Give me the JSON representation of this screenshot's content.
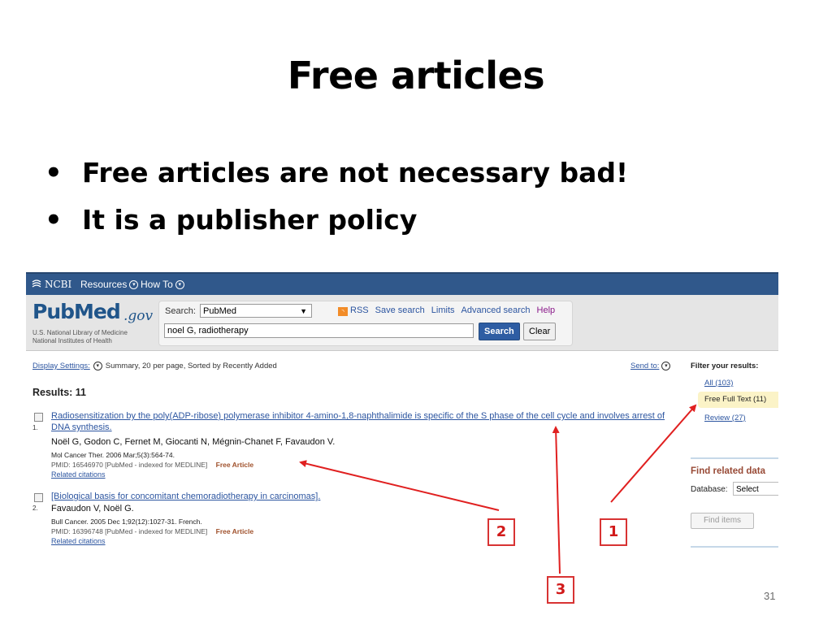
{
  "slide": {
    "title": "Free articles",
    "bullets": [
      "Free articles are not necessary bad!",
      "It is a publisher policy"
    ],
    "page_number": "31",
    "callouts": [
      "1",
      "2",
      "3"
    ],
    "arrow_color": "#e02020"
  },
  "ncbi_bar": {
    "brand": "NCBI",
    "items": [
      "Resources",
      "How To"
    ],
    "bg_color": "#30588b"
  },
  "logo": {
    "word": "PubMed",
    "gov": ".gov",
    "line1": "U.S. National Library of Medicine",
    "line2": "National Institutes of Health"
  },
  "search": {
    "label": "Search:",
    "database": "PubMed",
    "query": "noel G, radiotherapy",
    "search_button": "Search",
    "clear_button": "Clear",
    "links": [
      "RSS",
      "Save search",
      "Limits",
      "Advanced search",
      "Help"
    ]
  },
  "results_bar": {
    "display_settings": "Display Settings:",
    "display_value": "Summary, 20 per page, Sorted by Recently Added",
    "send_to": "Send to:",
    "results_count": "Results: 11"
  },
  "results": [
    {
      "number": "1.",
      "title": "Radiosensitization by the poly(ADP-ribose) polymerase inhibitor 4-amino-1,8-naphthalimide is specific of the S phase of the cell cycle and involves arrest of DNA synthesis.",
      "authors": "Noël G, Godon C, Fernet M, Giocanti N, Mégnin-Chanet F, Favaudon V.",
      "source": "Mol Cancer Ther. 2006 Mar;5(3):564-74.",
      "pmid": "PMID: 16546970 [PubMed - indexed for MEDLINE]",
      "free": "Free Article",
      "related": "Related citations"
    },
    {
      "number": "2.",
      "title": "[Biological basis for concomitant chemoradiotherapy in carcinomas].",
      "authors": "Favaudon V, Noël G.",
      "source": "Bull Cancer. 2005 Dec 1;92(12):1027-31. French.",
      "pmid": "PMID: 16396748 [PubMed - indexed for MEDLINE]",
      "free": "Free Article",
      "related": "Related citations"
    }
  ],
  "sidebar": {
    "filter_title": "Filter your results:",
    "filters": [
      "All (103)",
      "Free Full Text (11)",
      "Review (27)"
    ],
    "selected_filter": 1,
    "find_related_title": "Find related data",
    "database_label": "Database:",
    "database_value": "Select",
    "find_items_button": "Find items"
  }
}
